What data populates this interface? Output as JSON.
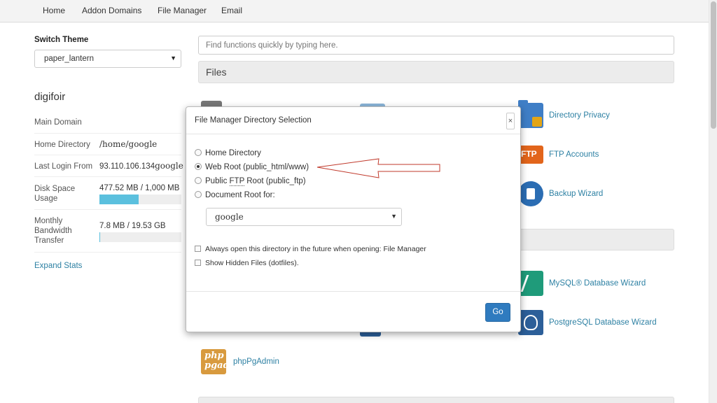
{
  "topnav": {
    "items": [
      "Home",
      "Addon Domains",
      "File Manager",
      "Email"
    ]
  },
  "sidebar": {
    "switch_theme_label": "Switch Theme",
    "theme_value": "paper_lantern",
    "account_name": "digifoir",
    "stats": [
      {
        "label": "Main Domain",
        "value": ""
      },
      {
        "label": "Home Directory",
        "value": "/home/google"
      },
      {
        "label": "Last Login From",
        "value": "93.110.106.134",
        "value_suffix": "google"
      },
      {
        "label": "Disk Space Usage",
        "value": "477.52 MB / 1,000 MB",
        "fill": 0.4775
      },
      {
        "label": "Monthly Bandwidth Transfer",
        "value": "7.8 MB / 19.53 GB",
        "fill": 0.004
      }
    ],
    "expand_stats": "Expand Stats"
  },
  "search": {
    "placeholder": "Find functions quickly by typing here."
  },
  "sections": {
    "files": "Files"
  },
  "functions": {
    "directory_privacy": "Directory Privacy",
    "ftp_accounts": "FTP Accounts",
    "backup_wizard": "Backup Wizard",
    "mysql_wizard": "MySQL® Database Wizard",
    "postgres_wizard": "PostgreSQL Database Wizard",
    "phppgadmin": "phpPgAdmin",
    "phppgadmin_logo": "php pgadmin"
  },
  "modal": {
    "title": "File Manager  Directory Selection",
    "close": "×",
    "options": {
      "home_directory": "Home Directory",
      "web_root": "Web Root (public_html/www)",
      "public_ftp_prefix": "Public ",
      "public_ftp_abbr": "FTP",
      "public_ftp_suffix": " Root (public_ftp)",
      "document_root": "Document Root for:"
    },
    "document_root_value": "google",
    "always_open": "Always open this directory in the future when opening: File Manager",
    "show_hidden": "Show Hidden Files (dotfiles).",
    "go_label": "Go"
  },
  "colors": {
    "link": "#2d80a3",
    "primary_button": "#2f7bbf",
    "progress": "#5bc0de",
    "annotation_arrow": "#c0392b"
  }
}
